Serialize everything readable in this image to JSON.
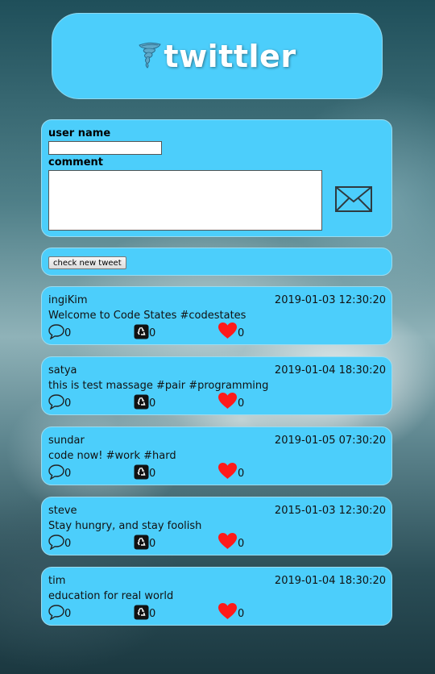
{
  "app": {
    "title": "twittler"
  },
  "form": {
    "username_label": "user name",
    "comment_label": "comment",
    "username_value": "",
    "comment_value": ""
  },
  "check_button_label": "check new tweet",
  "icons": {
    "logo": "tornado-icon",
    "send": "envelope-icon",
    "comment": "speech-bubble-icon",
    "retweet": "recycle-icon",
    "like": "heart-icon"
  },
  "colors": {
    "panel": "#4ccefb",
    "heart": "#ff1a1a"
  },
  "tweets": [
    {
      "user": "ingiKim",
      "date": "2019-01-03 12:30:20",
      "message": "Welcome to Code States #codestates",
      "comments": "0",
      "retweets": "0",
      "likes": "0"
    },
    {
      "user": "satya",
      "date": "2019-01-04 18:30:20",
      "message": "this is test massage #pair #programming",
      "comments": "0",
      "retweets": "0",
      "likes": "0"
    },
    {
      "user": "sundar",
      "date": "2019-01-05 07:30:20",
      "message": "code now! #work #hard",
      "comments": "0",
      "retweets": "0",
      "likes": "0"
    },
    {
      "user": "steve",
      "date": "2015-01-03 12:30:20",
      "message": "Stay hungry, and stay foolish",
      "comments": "0",
      "retweets": "0",
      "likes": "0"
    },
    {
      "user": "tim",
      "date": "2019-01-04 18:30:20",
      "message": "education for real world",
      "comments": "0",
      "retweets": "0",
      "likes": "0"
    }
  ]
}
